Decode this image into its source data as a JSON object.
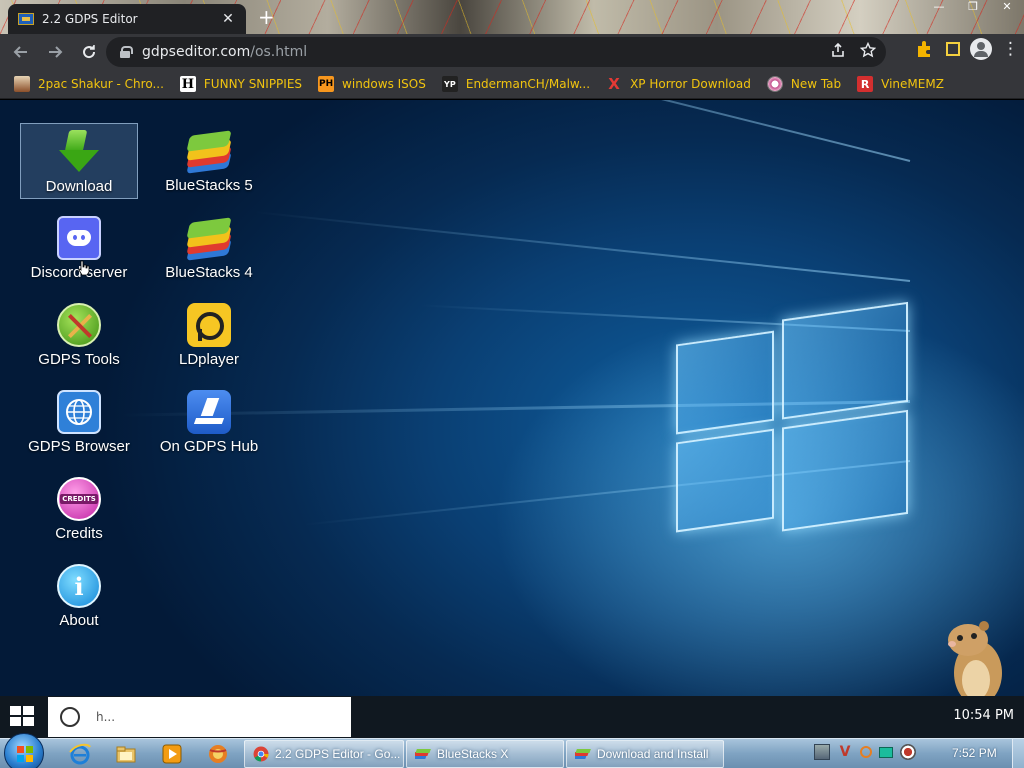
{
  "browser": {
    "tab_title": "2.2 GDPS Editor",
    "tab_close": "✕",
    "new_tab": "+",
    "window_buttons": [
      "—",
      "❐",
      "✕"
    ],
    "url_domain": "gdpseditor.com",
    "url_path": "/os.html",
    "bookmarks": [
      {
        "label": "2pac Shakur - Chro...",
        "icon": "album-icon",
        "icon_text": ""
      },
      {
        "label": "FUNNY SNIPPIES",
        "icon": "h-logo-icon",
        "icon_text": "H"
      },
      {
        "label": "windows ISOS",
        "icon": "ph-logo-icon",
        "icon_text": "PH"
      },
      {
        "label": "EndermanCH/Malw...",
        "icon": "yp-logo-icon",
        "icon_text": "YP"
      },
      {
        "label": "XP Horror Download",
        "icon": "x-icon",
        "icon_text": "X"
      },
      {
        "label": "New Tab",
        "icon": "globe-icon",
        "icon_text": ""
      },
      {
        "label": "VineMEMZ",
        "icon": "r-logo-icon",
        "icon_text": "R"
      }
    ]
  },
  "desktop": {
    "icons_left": [
      {
        "label": "Download",
        "icon": "download-icon",
        "selected": true
      },
      {
        "label": "Discord server",
        "icon": "discord-icon"
      },
      {
        "label": "GDPS Tools",
        "icon": "tools-icon"
      },
      {
        "label": "GDPS Browser",
        "icon": "browser-globe-icon"
      },
      {
        "label": "Credits",
        "icon": "credits-icon",
        "badge": "CREDITS"
      },
      {
        "label": "About",
        "icon": "info-icon",
        "glyph": "i"
      }
    ],
    "icons_right": [
      {
        "label": "BlueStacks 5",
        "icon": "bluestacks-icon"
      },
      {
        "label": "BlueStacks 4",
        "icon": "bluestacks-icon"
      },
      {
        "label": "LDplayer",
        "icon": "ldplayer-icon"
      },
      {
        "label": "On GDPS Hub",
        "icon": "gdps-hub-icon"
      }
    ]
  },
  "inner_taskbar": {
    "search_placeholder": "Type here to search...",
    "search_visible": "h...",
    "clock": "10:54 PM"
  },
  "w7_taskbar": {
    "items": [
      {
        "label": "2.2 GDPS Editor - Go...",
        "icon": "chrome-icon"
      },
      {
        "label": "BlueStacks X",
        "icon": "bluestacks-icon"
      },
      {
        "label": "Download and Install",
        "icon": "bluestacks-icon"
      }
    ],
    "clock": "7:52 PM"
  }
}
